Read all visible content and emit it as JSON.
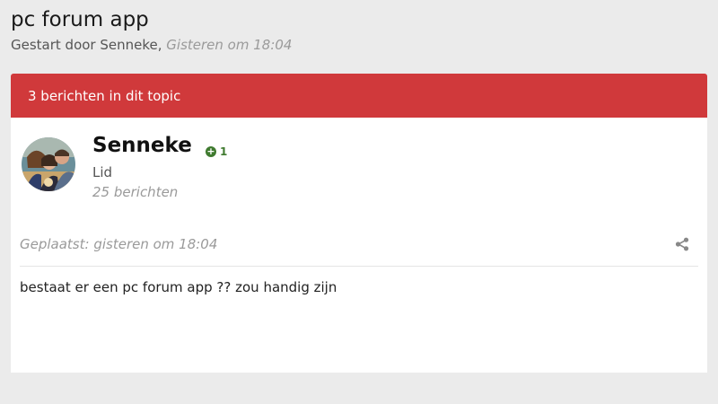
{
  "topic": {
    "title": "pc forum app",
    "started_by_prefix": "Gestart door Senneke,",
    "started_date": "Gisteren om 18:04"
  },
  "posts_count_label": "3 berichten in dit topic",
  "post": {
    "author": {
      "name": "Senneke",
      "reputation": "1",
      "role": "Lid",
      "post_count": "25 berichten"
    },
    "posted_label": "Geplaatst: gisteren om 18:04",
    "body": "bestaat er een pc forum app ?? zou handig zijn"
  },
  "colors": {
    "accent_red": "#d0393b",
    "reputation_green": "#3f7a2f"
  },
  "icons": [
    "share-icon",
    "plus-circle-icon",
    "avatar-photo"
  ]
}
